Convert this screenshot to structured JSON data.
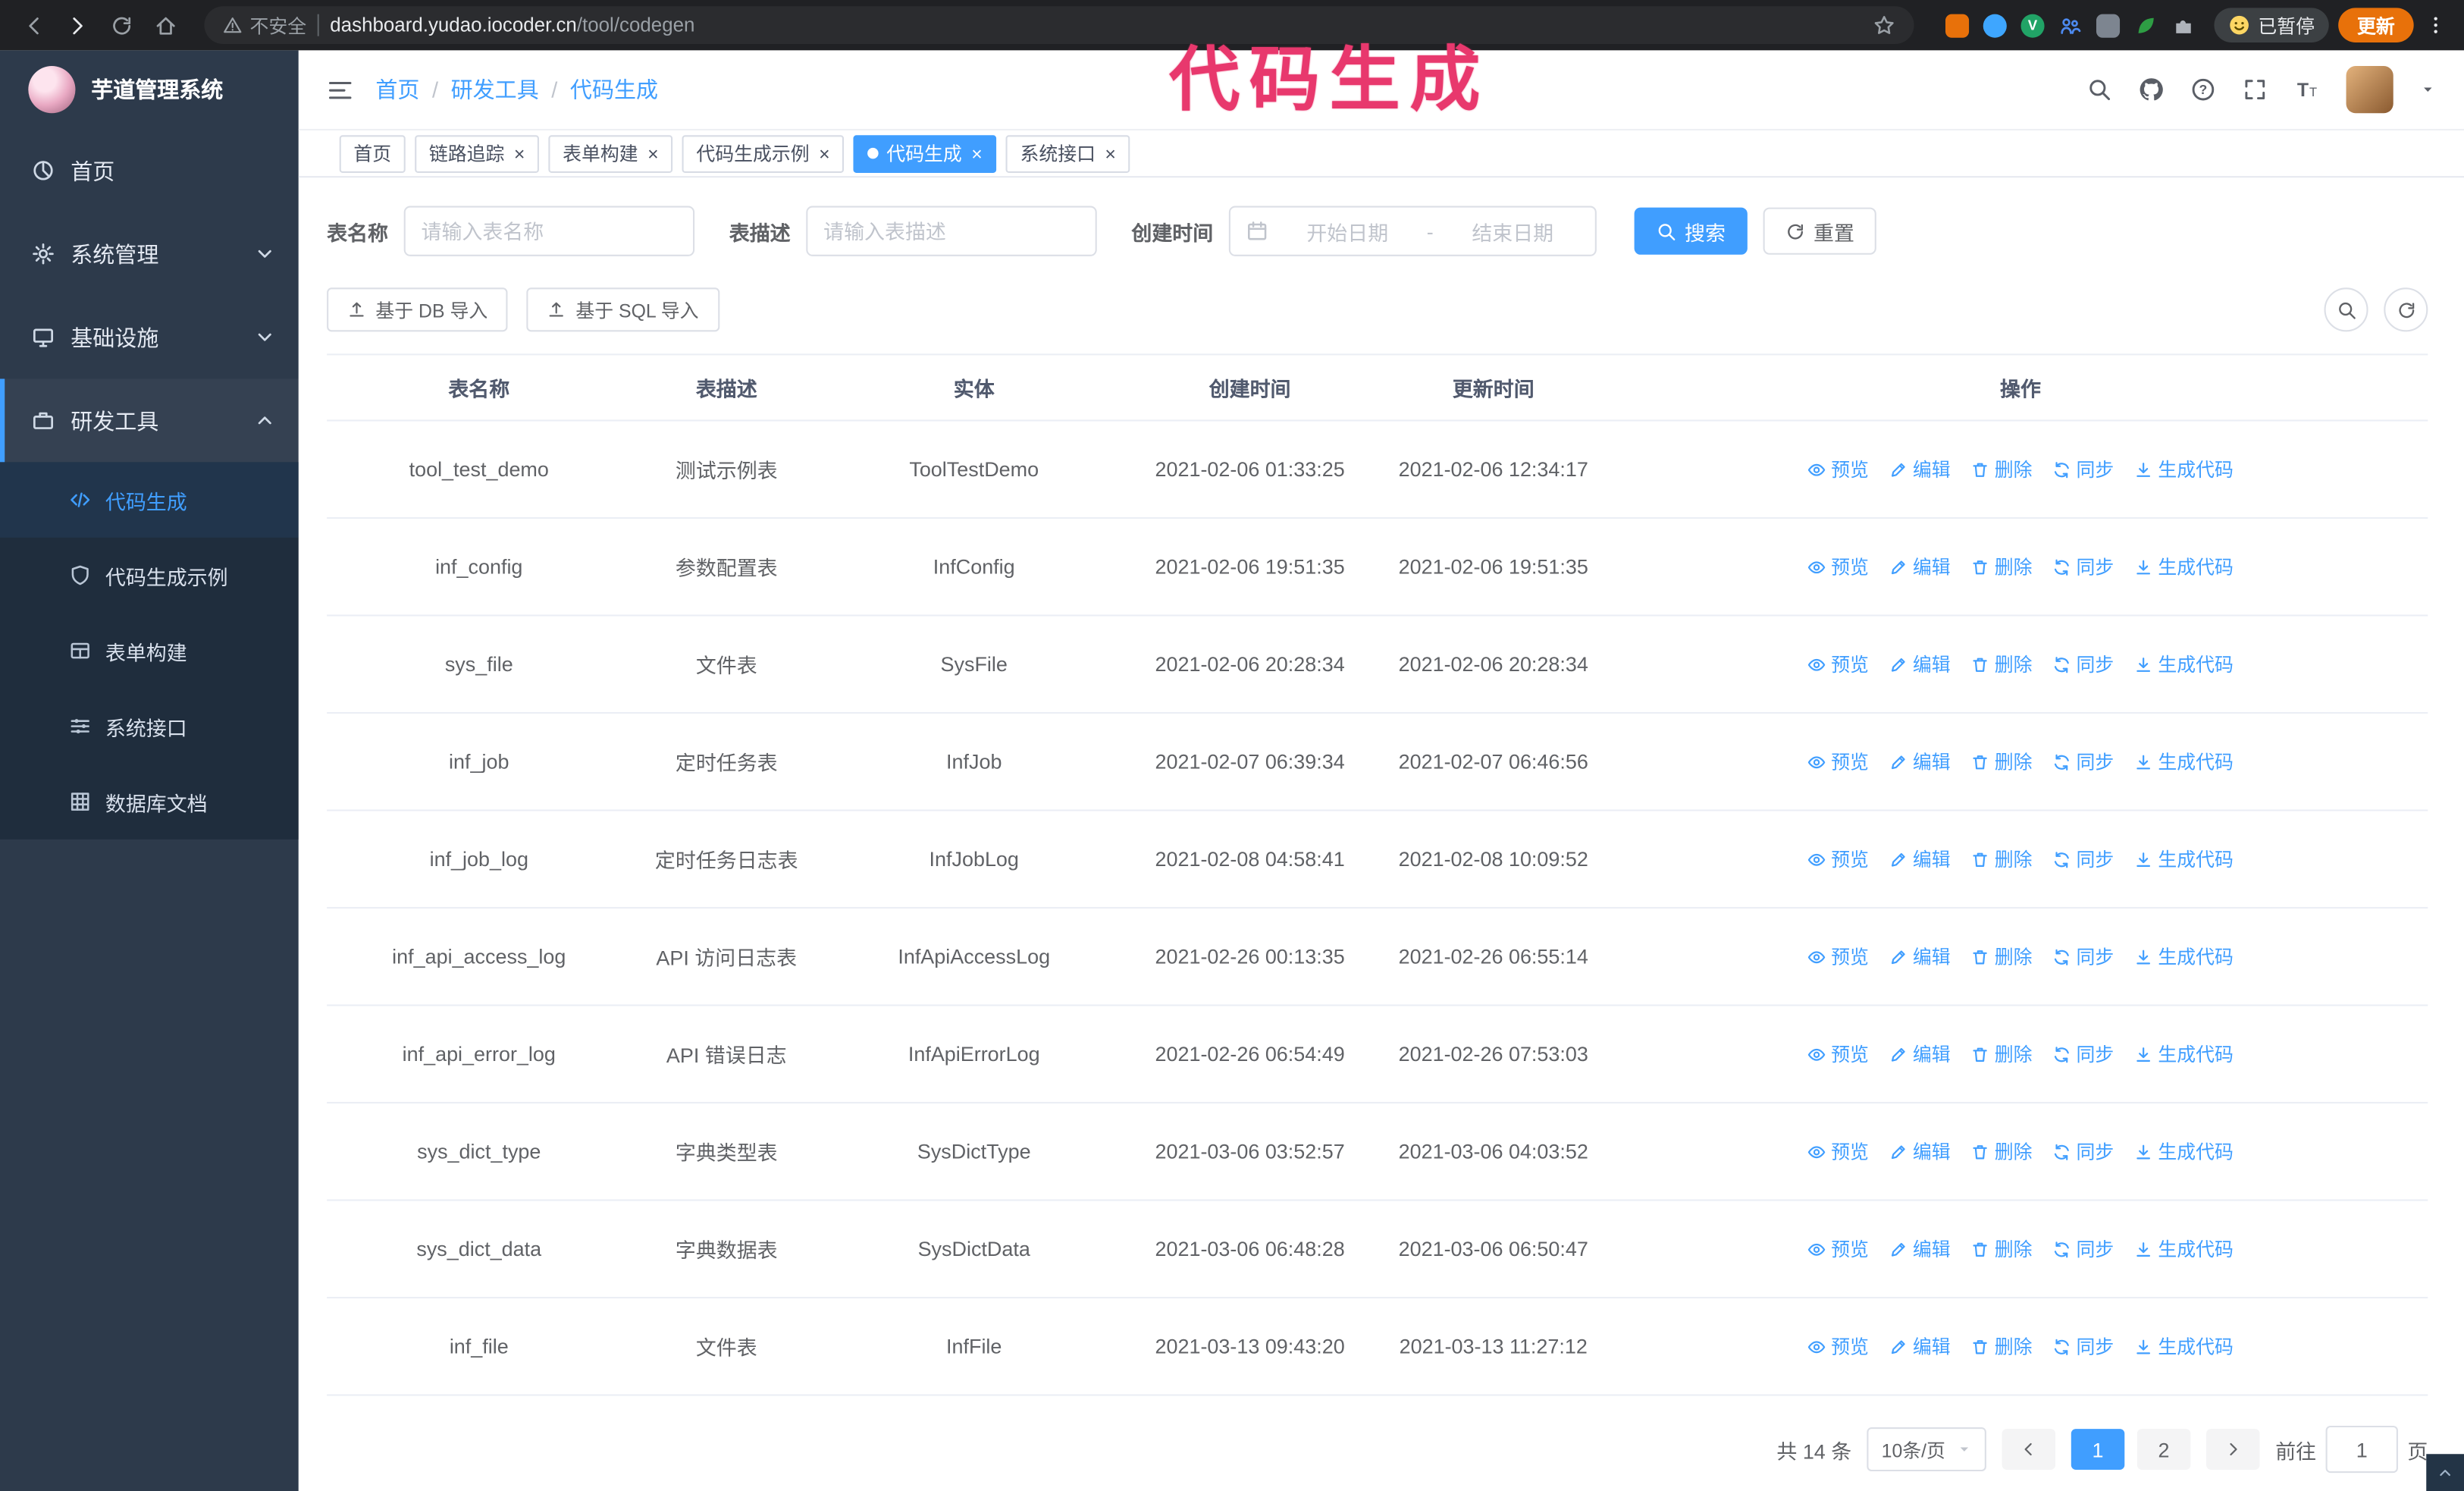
{
  "colors": {
    "accent": "#409eff",
    "annotation": "#e8386d",
    "sidebar_bg": "#2d3a4b",
    "submenu_bg": "#1f2d3d",
    "update_orange": "#e8710a"
  },
  "chrome": {
    "security_label": "不安全",
    "url_host": "dashboard.yudao.iocoder.cn",
    "url_path": "/tool/codegen",
    "paused_badge": "已暂停",
    "update_button": "更新",
    "extensions": [
      {
        "name": "ext-orange-icon",
        "color": "#e8710a",
        "shape": "square"
      },
      {
        "name": "ext-water-drop-icon",
        "color": "#3ea6ff"
      },
      {
        "name": "ext-green-v-icon",
        "color": "#21a366",
        "letter": "V"
      },
      {
        "name": "ext-people-icon",
        "color": "#4d8af0",
        "icon": "people-icon"
      },
      {
        "name": "ext-gray-tool-icon",
        "color": "#7d8590",
        "shape": "square"
      },
      {
        "name": "ext-leaf-icon",
        "color": "#2e9e44",
        "icon": "leaf-icon"
      },
      {
        "name": "ext-puzzle-icon",
        "color": "#aeb3ba",
        "icon": "puzzle-icon"
      }
    ]
  },
  "annotation": {
    "text": "代码生成"
  },
  "sidebar": {
    "logo_title": "芋道管理系统",
    "items": [
      {
        "name": "sidebar-item-home",
        "label": "首页",
        "icon": "dashboard-icon"
      },
      {
        "name": "sidebar-item-system",
        "label": "系统管理",
        "icon": "gear-icon",
        "chevron": "down"
      },
      {
        "name": "sidebar-item-infra",
        "label": "基础设施",
        "icon": "monitor-icon",
        "chevron": "down"
      },
      {
        "name": "sidebar-item-devtools",
        "label": "研发工具",
        "icon": "tool-icon",
        "chevron": "up",
        "expanded": true
      }
    ],
    "submenu": [
      {
        "name": "sidebar-item-codegen",
        "label": "代码生成",
        "icon": "code-icon",
        "active": true
      },
      {
        "name": "sidebar-item-codegen-example",
        "label": "代码生成示例",
        "icon": "shield-icon"
      },
      {
        "name": "sidebar-item-form-builder",
        "label": "表单构建",
        "icon": "form-icon"
      },
      {
        "name": "sidebar-item-system-api",
        "label": "系统接口",
        "icon": "sliders-icon"
      },
      {
        "name": "sidebar-item-db-doc",
        "label": "数据库文档",
        "icon": "grid-icon"
      }
    ]
  },
  "header": {
    "breadcrumb": [
      "首页",
      "研发工具",
      "代码生成"
    ]
  },
  "tabs": [
    {
      "name": "tab-home",
      "label": "首页",
      "closable": false,
      "active": false
    },
    {
      "name": "tab-trace",
      "label": "链路追踪",
      "closable": true,
      "active": false
    },
    {
      "name": "tab-form-builder",
      "label": "表单构建",
      "closable": true,
      "active": false
    },
    {
      "name": "tab-codegen-example",
      "label": "代码生成示例",
      "closable": true,
      "active": false
    },
    {
      "name": "tab-codegen",
      "label": "代码生成",
      "closable": true,
      "active": true
    },
    {
      "name": "tab-system-api",
      "label": "系统接口",
      "closable": true,
      "active": false
    }
  ],
  "filters": {
    "table_name_label": "表名称",
    "table_name_placeholder": "请输入表名称",
    "table_desc_label": "表描述",
    "table_desc_placeholder": "请输入表描述",
    "create_time_label": "创建时间",
    "start_placeholder": "开始日期",
    "range_separator": "-",
    "end_placeholder": "结束日期",
    "search_label": "搜索",
    "reset_label": "重置"
  },
  "toolbar": {
    "import_db_label": "基于 DB 导入",
    "import_sql_label": "基于 SQL 导入"
  },
  "table": {
    "columns": [
      "表名称",
      "表描述",
      "实体",
      "创建时间",
      "更新时间",
      "操作"
    ],
    "actions": [
      {
        "name": "preview-action",
        "label": "预览",
        "icon": "eye-icon"
      },
      {
        "name": "edit-action",
        "label": "编辑",
        "icon": "edit-icon"
      },
      {
        "name": "delete-action",
        "label": "删除",
        "icon": "delete-icon"
      },
      {
        "name": "sync-action",
        "label": "同步",
        "icon": "sync-icon"
      },
      {
        "name": "generate-code-action",
        "label": "生成代码",
        "icon": "download-icon"
      }
    ],
    "rows": [
      {
        "name": "tool_test_demo",
        "desc": "测试示例表",
        "entity": "ToolTestDemo",
        "created": "2021-02-06 01:33:25",
        "updated": "2021-02-06 12:34:17"
      },
      {
        "name": "inf_config",
        "desc": "参数配置表",
        "entity": "InfConfig",
        "created": "2021-02-06 19:51:35",
        "updated": "2021-02-06 19:51:35"
      },
      {
        "name": "sys_file",
        "desc": "文件表",
        "entity": "SysFile",
        "created": "2021-02-06 20:28:34",
        "updated": "2021-02-06 20:28:34"
      },
      {
        "name": "inf_job",
        "desc": "定时任务表",
        "entity": "InfJob",
        "created": "2021-02-07 06:39:34",
        "updated": "2021-02-07 06:46:56"
      },
      {
        "name": "inf_job_log",
        "desc": "定时任务日志表",
        "entity": "InfJobLog",
        "created": "2021-02-08 04:58:41",
        "updated": "2021-02-08 10:09:52"
      },
      {
        "name": "inf_api_access_log",
        "desc": "API 访问日志表",
        "entity": "InfApiAccessLog",
        "created": "2021-02-26 00:13:35",
        "updated": "2021-02-26 06:55:14"
      },
      {
        "name": "inf_api_error_log",
        "desc": "API 错误日志",
        "entity": "InfApiErrorLog",
        "created": "2021-02-26 06:54:49",
        "updated": "2021-02-26 07:53:03"
      },
      {
        "name": "sys_dict_type",
        "desc": "字典类型表",
        "entity": "SysDictType",
        "created": "2021-03-06 03:52:57",
        "updated": "2021-03-06 04:03:52"
      },
      {
        "name": "sys_dict_data",
        "desc": "字典数据表",
        "entity": "SysDictData",
        "created": "2021-03-06 06:48:28",
        "updated": "2021-03-06 06:50:47"
      },
      {
        "name": "inf_file",
        "desc": "文件表",
        "entity": "InfFile",
        "created": "2021-03-13 09:43:20",
        "updated": "2021-03-13 11:27:12"
      }
    ]
  },
  "pagination": {
    "total": "共 14 条",
    "page_size": "10条/页",
    "pages": [
      "1",
      "2"
    ],
    "active_page": "1",
    "goto_label": "前往",
    "goto_value": "1",
    "page_label": "页"
  }
}
